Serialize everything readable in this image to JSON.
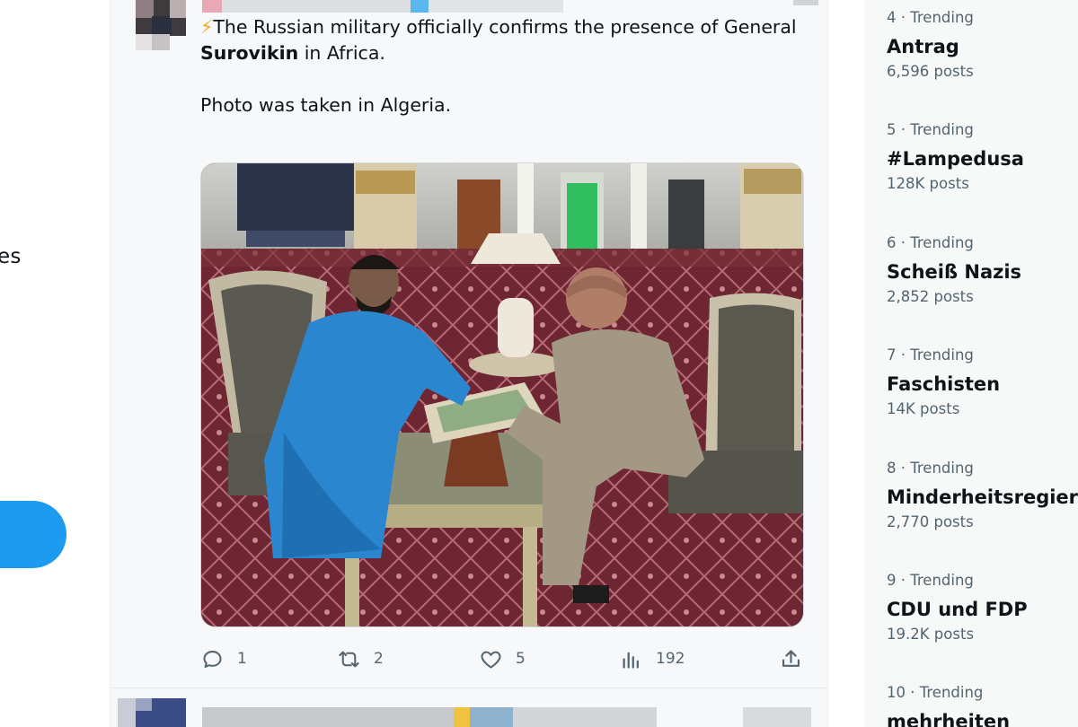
{
  "left_nav": {
    "label_fragment": "es",
    "accent": "#1d9bf0"
  },
  "tweet": {
    "text_part1": "The Russian military officially confirms the presence of General ",
    "text_bold": "Surovikin",
    "text_part2": " in Africa.",
    "text_line2": "Photo was taken in Algeria.",
    "icon_prefix": "⚡",
    "stats": {
      "replies": "1",
      "reposts": "2",
      "likes": "5",
      "views": "192"
    }
  },
  "trends": [
    {
      "meta": "4 · Trending",
      "name": "Antrag",
      "count": "6,596 posts"
    },
    {
      "meta": "5 · Trending",
      "name": "#Lampedusa",
      "count": "128K posts"
    },
    {
      "meta": "6 · Trending",
      "name": "Scheiß Nazis",
      "count": "2,852 posts"
    },
    {
      "meta": "7 · Trending",
      "name": "Faschisten",
      "count": "14K posts"
    },
    {
      "meta": "8 · Trending",
      "name": "Minderheitsregierung",
      "count": "2,770 posts"
    },
    {
      "meta": "9 · Trending",
      "name": "CDU und FDP",
      "count": "19.2K posts"
    },
    {
      "meta": "10 · Trending",
      "name": "mehrheiten",
      "count": ""
    }
  ],
  "icons": {
    "reply": "speech-bubble-icon",
    "repost": "repost-arrows-icon",
    "like": "heart-icon",
    "views": "bar-chart-icon",
    "share": "share-upload-icon"
  }
}
